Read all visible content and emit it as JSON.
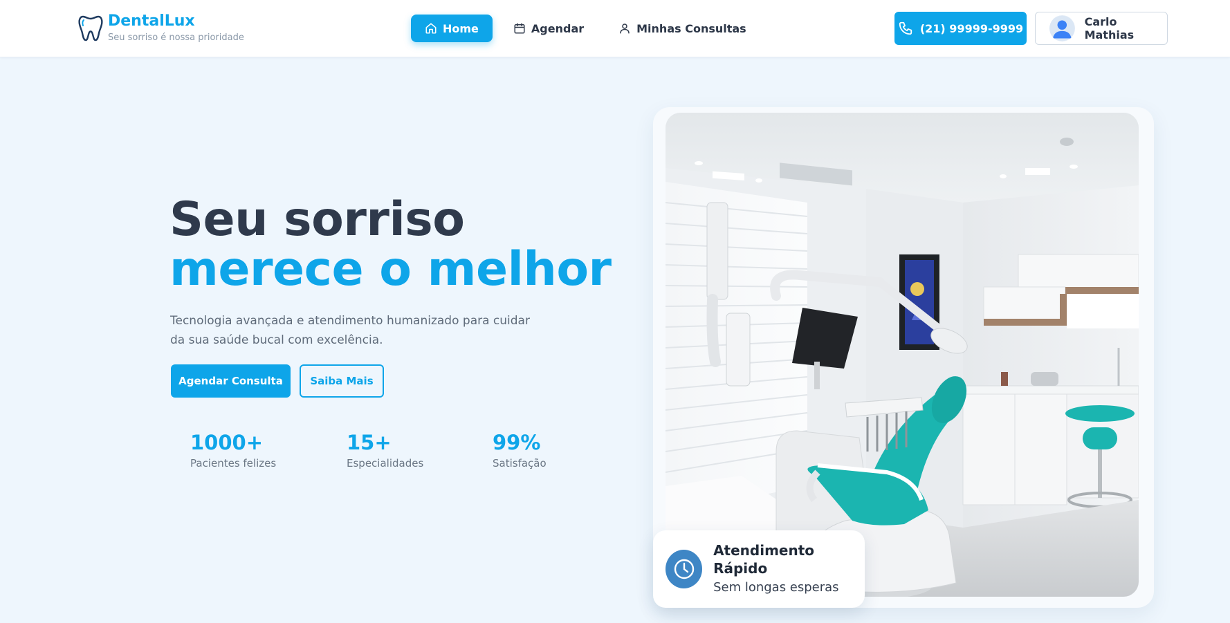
{
  "header": {
    "brand": "DentalLux",
    "tagline": "Seu sorriso é nossa prioridade",
    "logo_icon": "tooth-icon",
    "nav": [
      {
        "label": "Home",
        "icon": "home-icon",
        "active": true
      },
      {
        "label": "Agendar",
        "icon": "calendar-icon",
        "active": false
      },
      {
        "label": "Minhas Consultas",
        "icon": "user-icon",
        "active": false
      }
    ],
    "phone": {
      "label": "(21) 99999-9999",
      "icon": "phone-icon"
    },
    "user": {
      "name": "Carlo Mathias",
      "icon": "avatar"
    }
  },
  "hero": {
    "title_line1": "Seu sorriso",
    "title_line2": "merece o melhor",
    "description": "Tecnologia avançada e atendimento humanizado para cuidar da sua saúde bucal com excelência.",
    "primary_button": "Agendar Consulta",
    "secondary_button": "Saiba Mais",
    "stats": [
      {
        "value": "1000+",
        "label": "Pacientes felizes"
      },
      {
        "value": "15+",
        "label": "Especialidades"
      },
      {
        "value": "99%",
        "label": "Satisfação"
      }
    ]
  },
  "image": {
    "subject": "dental-clinic-room"
  },
  "badge": {
    "title": "Atendimento Rápido",
    "subtitle": "Sem longas esperas",
    "icon": "clock-icon"
  },
  "colors": {
    "accent": "#0ea5e9",
    "page_background": "#eef6fd",
    "dark_text": "#2f3a4c",
    "badge_icon_bg": "#3e86c5",
    "chair_teal": "#1bb5b0"
  }
}
